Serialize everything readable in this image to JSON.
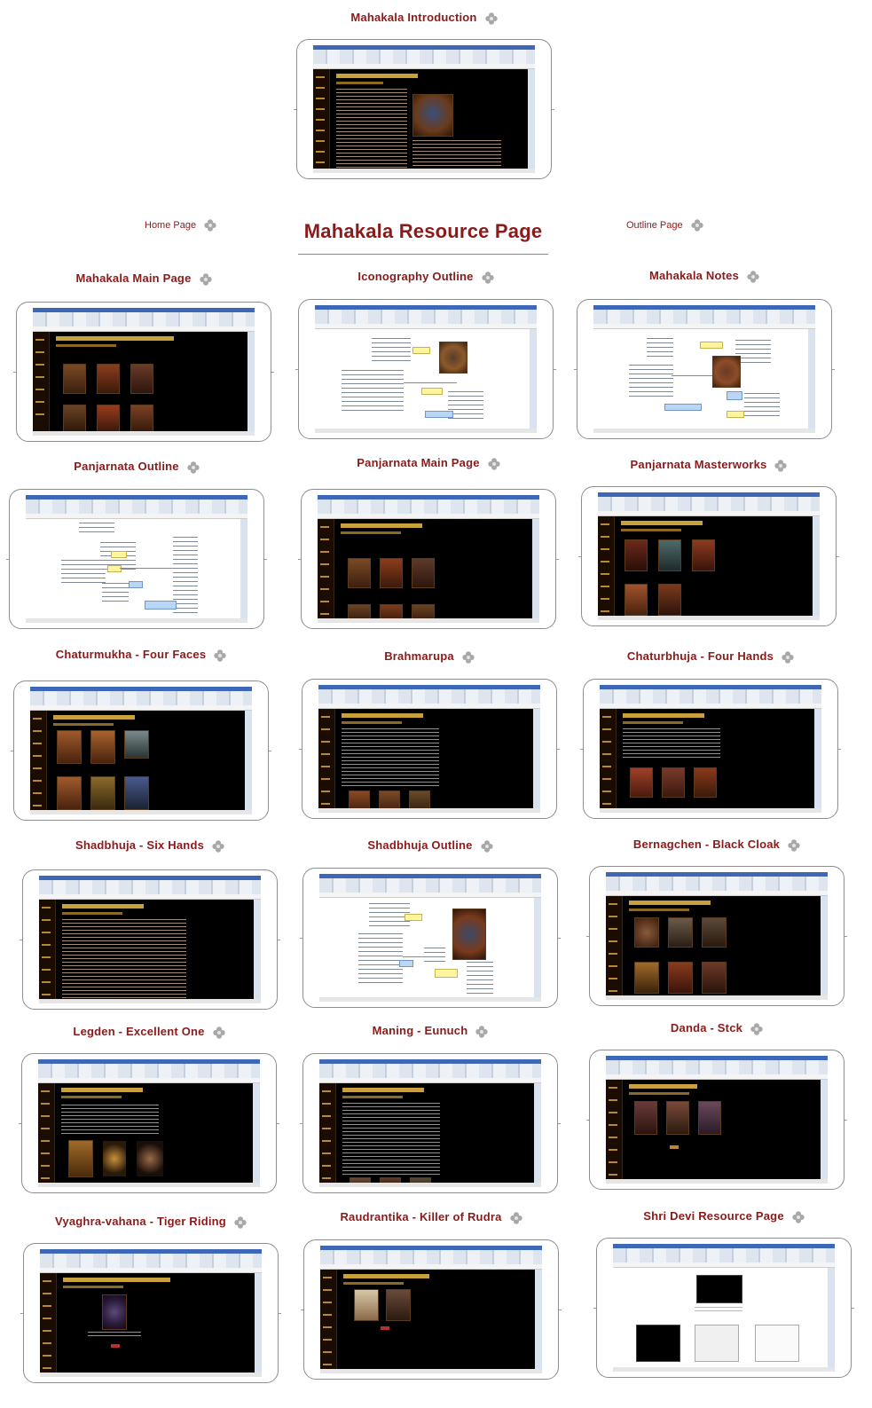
{
  "root": {
    "title": "Mahakala Resource Page"
  },
  "nav": {
    "home": "Home Page",
    "outline": "Outline Page"
  },
  "topics": {
    "intro": "Mahakala Introduction",
    "main": "Mahakala Main Page",
    "icon_outline": "Iconography Outline",
    "notes": "Mahakala Notes",
    "panj_outline": "Panjarnata Outline",
    "panj_main": "Panjarnata Main Page",
    "panj_master": "Panjarnata Masterworks",
    "chaturmukha": "Chaturmukha - Four Faces",
    "brahmarupa": "Brahmarupa",
    "chaturbhuja": "Chaturbhuja - Four Hands",
    "shadbhuja": "Shadbhuja - Six Hands",
    "shad_outline": "Shadbhuja Outline",
    "bernagchen": "Bernagchen - Black Cloak",
    "legden": "Legden - Excellent One",
    "maning": "Maning - Eunuch",
    "danda": "Danda - Stck",
    "vyaghra": "Vyaghra-vahana - Tiger Riding",
    "raudrantika": "Raudrantika - Killer of Rudra",
    "shridevi": "Shri Devi Resource Page"
  },
  "colors": {
    "topic_text": "#8b1a1a",
    "border": "#8e8e8e",
    "browser_chrome": "#3e67b8",
    "page_bg": "#000000"
  },
  "icons": {
    "topic_link": "clover-link-icon"
  }
}
